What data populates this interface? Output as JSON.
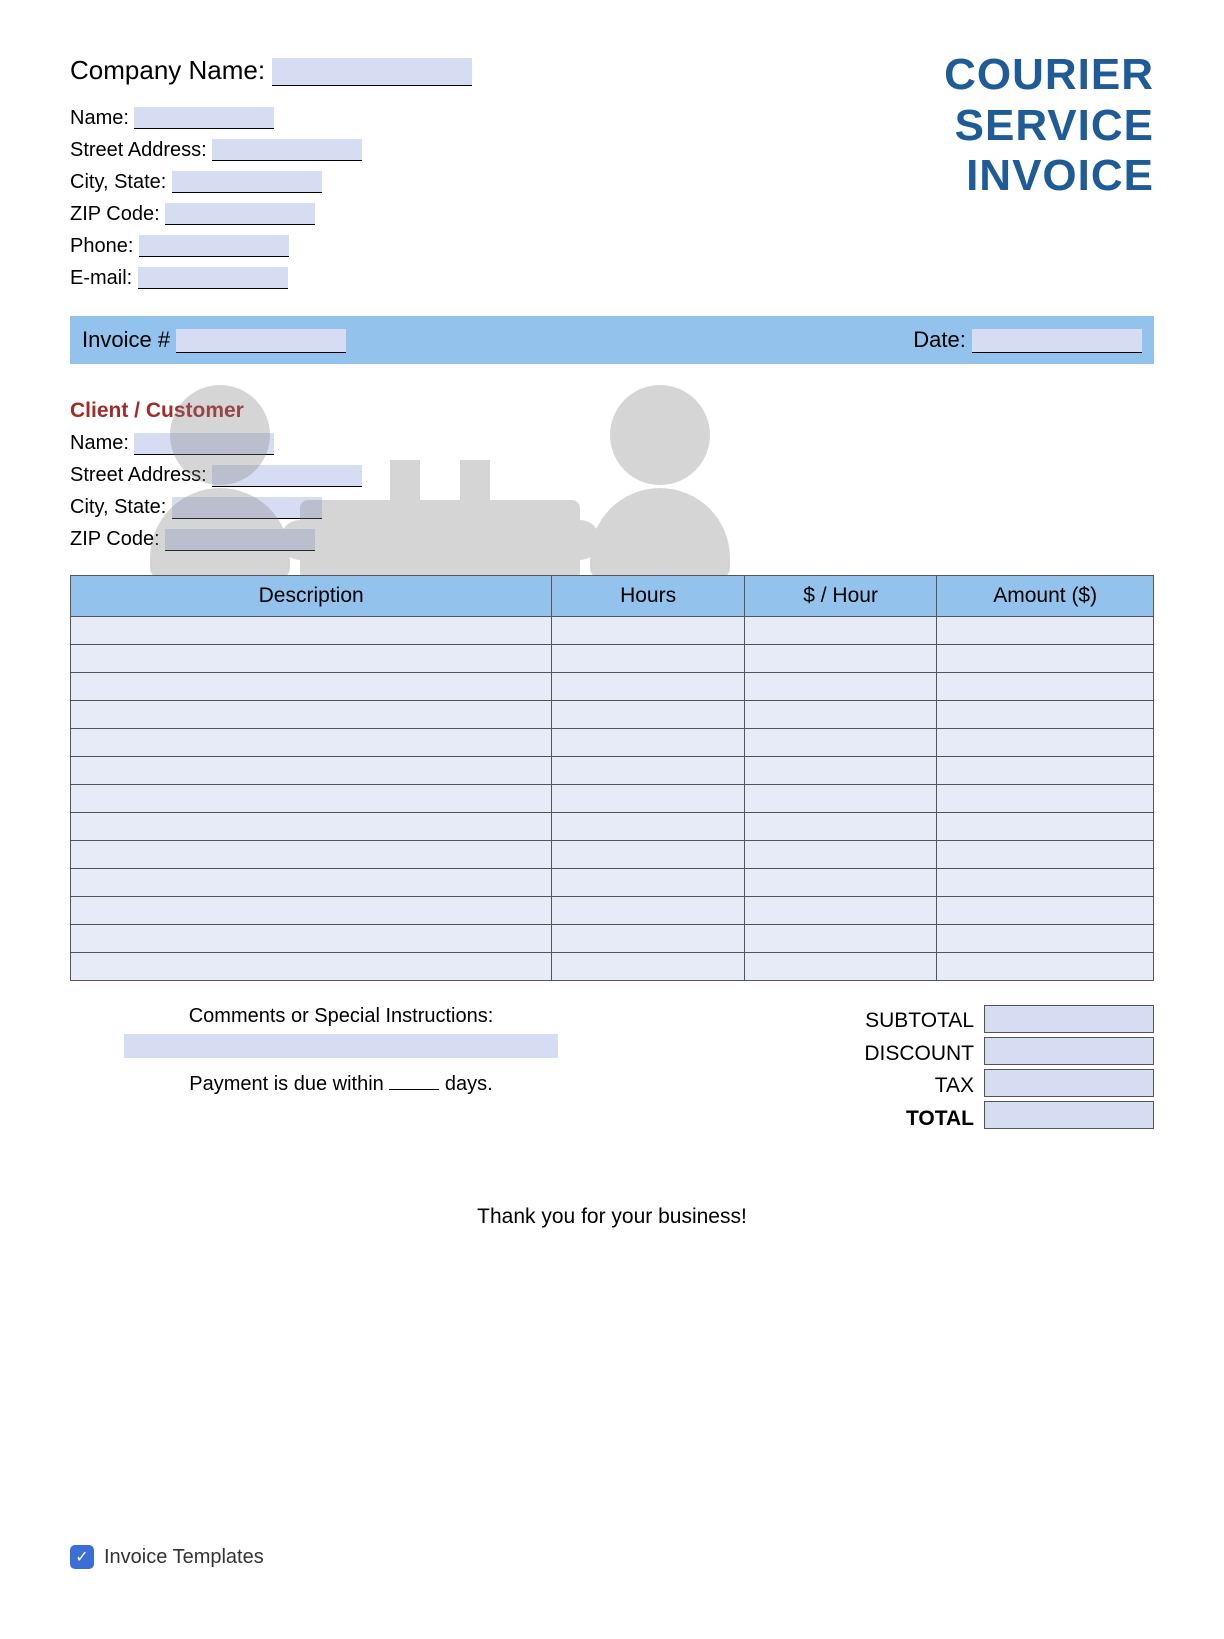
{
  "title": {
    "line1": "COURIER",
    "line2": "SERVICE",
    "line3": "INVOICE"
  },
  "company": {
    "company_name_label": "Company Name:",
    "name_label": "Name:",
    "street_label": "Street Address:",
    "city_label": "City, State:",
    "zip_label": "ZIP Code:",
    "phone_label": "Phone:",
    "email_label": "E-mail:"
  },
  "invoice_bar": {
    "number_label": "Invoice #",
    "date_label": "Date:"
  },
  "client": {
    "heading": "Client / Customer",
    "name_label": "Name:",
    "street_label": "Street Address:",
    "city_label": "City, State:",
    "zip_label": "ZIP Code:"
  },
  "table": {
    "headers": {
      "description": "Description",
      "hours": "Hours",
      "rate": "$ / Hour",
      "amount": "Amount ($)"
    },
    "row_count": 13
  },
  "comments": {
    "heading": "Comments or Special Instructions:",
    "payment_prefix": "Payment is due within",
    "payment_suffix": "days."
  },
  "totals": {
    "subtotal": "SUBTOTAL",
    "discount": "DISCOUNT",
    "tax": "TAX",
    "total": "TOTAL"
  },
  "thanks": "Thank you for your business!",
  "footer_brand": "Invoice Templates",
  "footer_check": "✓"
}
